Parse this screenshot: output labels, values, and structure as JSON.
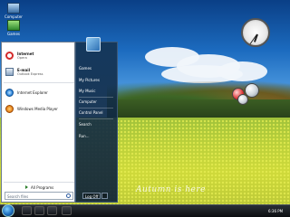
{
  "desktop": {
    "icons": [
      {
        "label": "Computer",
        "icon": "computer-icon"
      },
      {
        "label": "Games",
        "icon": "games-icon"
      }
    ],
    "watermark_text": "Autumn is here"
  },
  "start_menu": {
    "pinned": [
      {
        "title": "Internet",
        "subtitle": "Opera",
        "icon": "opera-icon"
      },
      {
        "title": "E-mail",
        "subtitle": "Outlook Express",
        "icon": "email-icon"
      }
    ],
    "recent": [
      {
        "title": "Internet Explorer",
        "icon": "ie-icon"
      },
      {
        "title": "Windows Media Player",
        "icon": "media-player-icon"
      }
    ],
    "all_programs_label": "All Programs",
    "search_placeholder": "Search files",
    "right_links": [
      "Games",
      "My Pictures",
      "My Music",
      "Computer",
      "Control Panel",
      "Search",
      "Run..."
    ],
    "logoff_label": "Log Off"
  },
  "taskbar": {
    "time": "6:36 PM"
  },
  "colors": {
    "accent": "#1e6fbf",
    "opera_red": "#d42b2b"
  }
}
